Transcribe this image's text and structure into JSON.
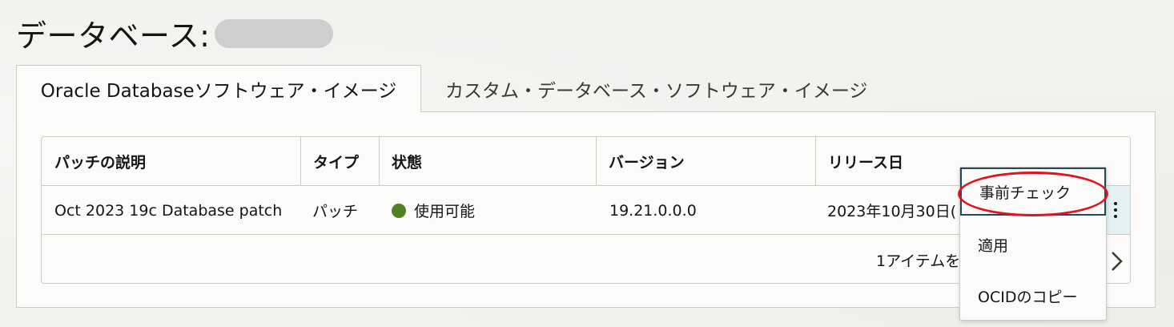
{
  "page": {
    "title": "データベース:"
  },
  "tabs": [
    {
      "label": "Oracle Databaseソフトウェア・イメージ",
      "active": true
    },
    {
      "label": "カスタム・データベース・ソフトウェア・イメージ",
      "active": false
    }
  ],
  "table": {
    "headers": [
      "パッチの説明",
      "タイプ",
      "状態",
      "バージョン",
      "リリース日"
    ],
    "rows": [
      {
        "description": "Oct 2023 19c Database patch",
        "type": "パッチ",
        "status": "使用可能",
        "version": "19.21.0.0.0",
        "release_date": "2023年10月30日("
      }
    ],
    "footer": "1アイテムを",
    "status_color": "#508223"
  },
  "menu": {
    "items": [
      {
        "label": "事前チェック"
      },
      {
        "label": "適用"
      },
      {
        "label": "OCIDのコピー"
      }
    ]
  },
  "icons": {
    "status": "status-dot-icon",
    "actions": "kebab-icon",
    "next": "chevron-right-icon"
  },
  "colors": {
    "accent_focus": "#1e4a5c",
    "highlight": "#e0141e"
  }
}
